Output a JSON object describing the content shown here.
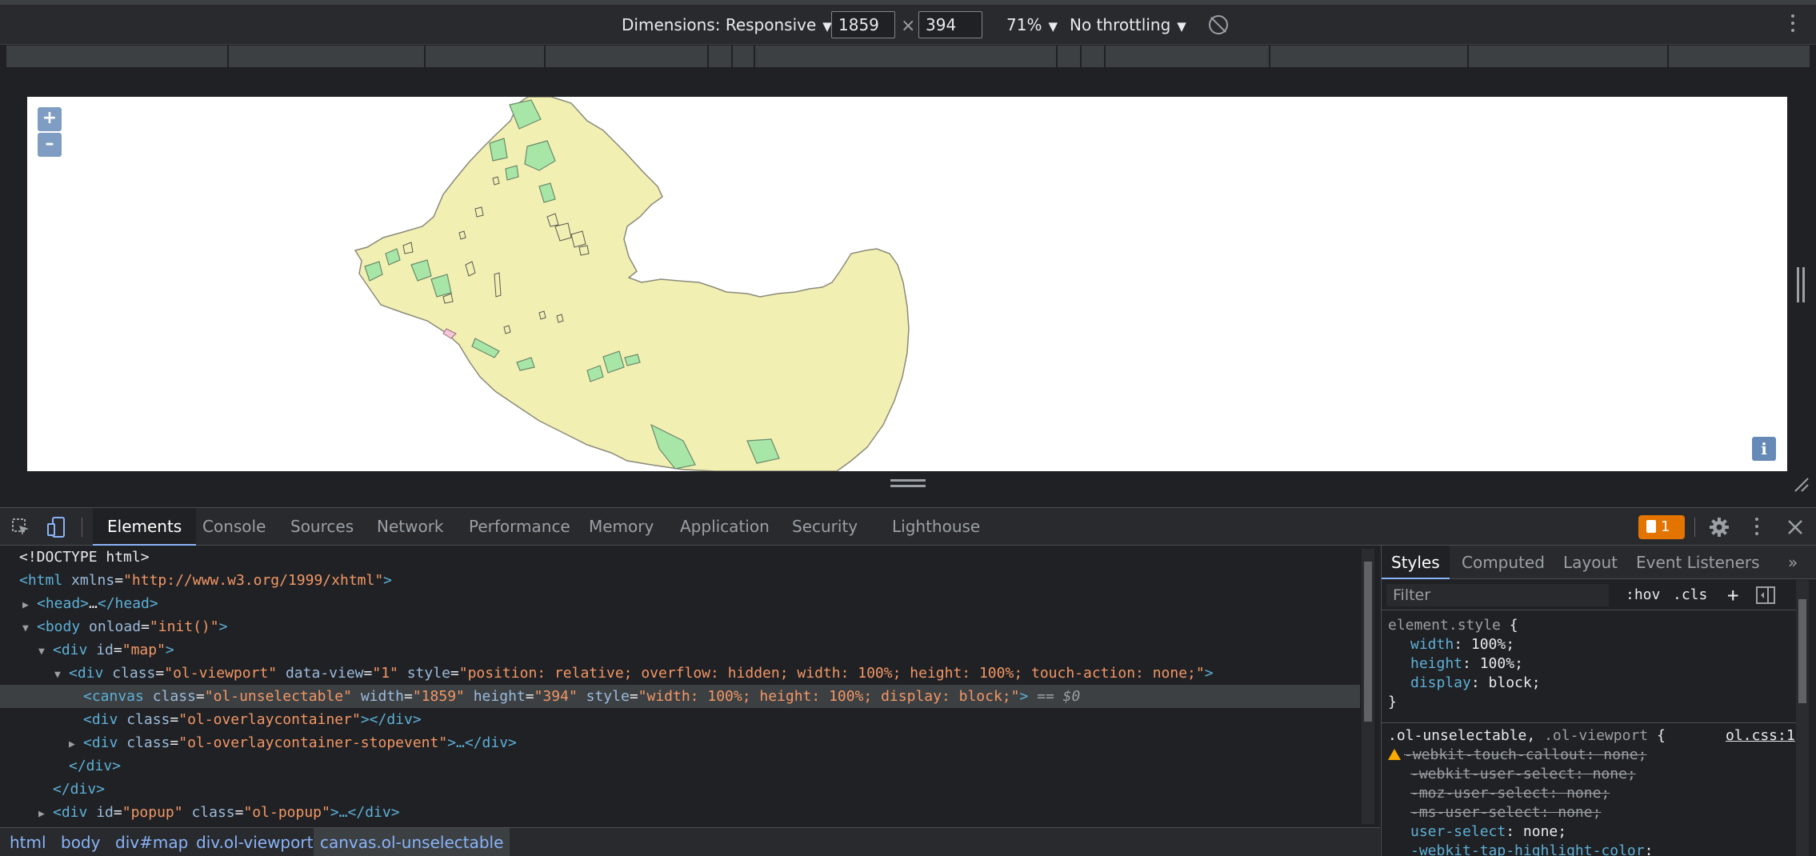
{
  "device_toolbar": {
    "dimensions_label": "Dimensions: Responsive",
    "width_value": "1859",
    "times": "×",
    "height_value": "394",
    "zoom": "71%",
    "throttling": "No throttling",
    "caret": "▼"
  },
  "map": {
    "zoom_in": "+",
    "zoom_out": "–",
    "info": "i",
    "colors": {
      "land": "#f2efb3",
      "parks": "#a8e6a8",
      "outline": "#8a8a7a"
    }
  },
  "devtools_tabs": [
    "Elements",
    "Console",
    "Sources",
    "Network",
    "Performance",
    "Memory",
    "Application",
    "Security",
    "Lighthouse"
  ],
  "issues_count": "1",
  "dom": {
    "l1": "<!DOCTYPE html>",
    "l2_tag": "<html",
    "l2_attr": "xmlns",
    "l2_val": "\"http://www.w3.org/1999/xhtml\"",
    "l2_end": ">",
    "l3_tag": "<head>",
    "l3_dots": "…",
    "l3_end": "</head>",
    "l4_tag": "<body",
    "l4_attr": "onload",
    "l4_val": "\"init()\"",
    "l4_end": ">",
    "l5_tag": "<div",
    "l5_attr": "id",
    "l5_val": "\"map\"",
    "l5_end": ">",
    "l6_tag": "<div",
    "l6_a1": "class",
    "l6_v1": "\"ol-viewport\"",
    "l6_a2": "data-view",
    "l6_v2": "\"1\"",
    "l6_a3": "style",
    "l6_v3": "\"position: relative; overflow: hidden; width: 100%; height: 100%; touch-action: none;\"",
    "l6_end": ">",
    "l7_tag": "<canvas",
    "l7_a1": "class",
    "l7_v1": "\"ol-unselectable\"",
    "l7_a2": "width",
    "l7_v2": "\"1859\"",
    "l7_a3": "height",
    "l7_v3": "\"394\"",
    "l7_a4": "style",
    "l7_v4": "\"width: 100%; height: 100%; display: block;\"",
    "l7_end": ">",
    "l7_dollar": "== $0",
    "l8_tag": "<div",
    "l8_attr": "class",
    "l8_val": "\"ol-overlaycontainer\"",
    "l8_end": "></div>",
    "l9_tag": "<div",
    "l9_attr": "class",
    "l9_val": "\"ol-overlaycontainer-stopevent\"",
    "l9_end": ">…</div>",
    "l10": "</div>",
    "l11": "</div>",
    "l12_tag": "<div",
    "l12_a1": "id",
    "l12_v1": "\"popup\"",
    "l12_a2": "class",
    "l12_v2": "\"ol-popup\"",
    "l12_end": ">…</div>",
    "eq": "="
  },
  "breadcrumbs": [
    "html",
    "body",
    "div#map",
    "div.ol-viewport",
    "canvas.ol-unselectable"
  ],
  "styles_panel": {
    "tabs": [
      "Styles",
      "Computed",
      "Layout",
      "Event Listeners",
      "»"
    ],
    "filter_placeholder": "Filter",
    "hov": ":hov",
    "cls": ".cls",
    "plus": "+",
    "element_style_selector": "element.style",
    "open_brace": "{",
    "close_brace": "}",
    "rules": [
      {
        "prop": "width",
        "value": "100%;"
      },
      {
        "prop": "height",
        "value": "100%;"
      },
      {
        "prop": "display",
        "value": "block;"
      }
    ],
    "rule2_selector_a": ".ol-unselectable,",
    "rule2_selector_b": ".ol-viewport",
    "rule2_link": "ol.css:1",
    "rule2_props": [
      {
        "prop": "-webkit-touch-callout",
        "value": "none;"
      },
      {
        "prop": "-webkit-user-select",
        "value": "none;"
      },
      {
        "prop": "-moz-user-select",
        "value": "none;"
      },
      {
        "prop": "-ms-user-select",
        "value": "none;"
      },
      {
        "prop": "user-select",
        "value": "none;"
      },
      {
        "prop": "-webkit-tap-highlight-color",
        "value": ""
      }
    ],
    "colon": ":"
  }
}
